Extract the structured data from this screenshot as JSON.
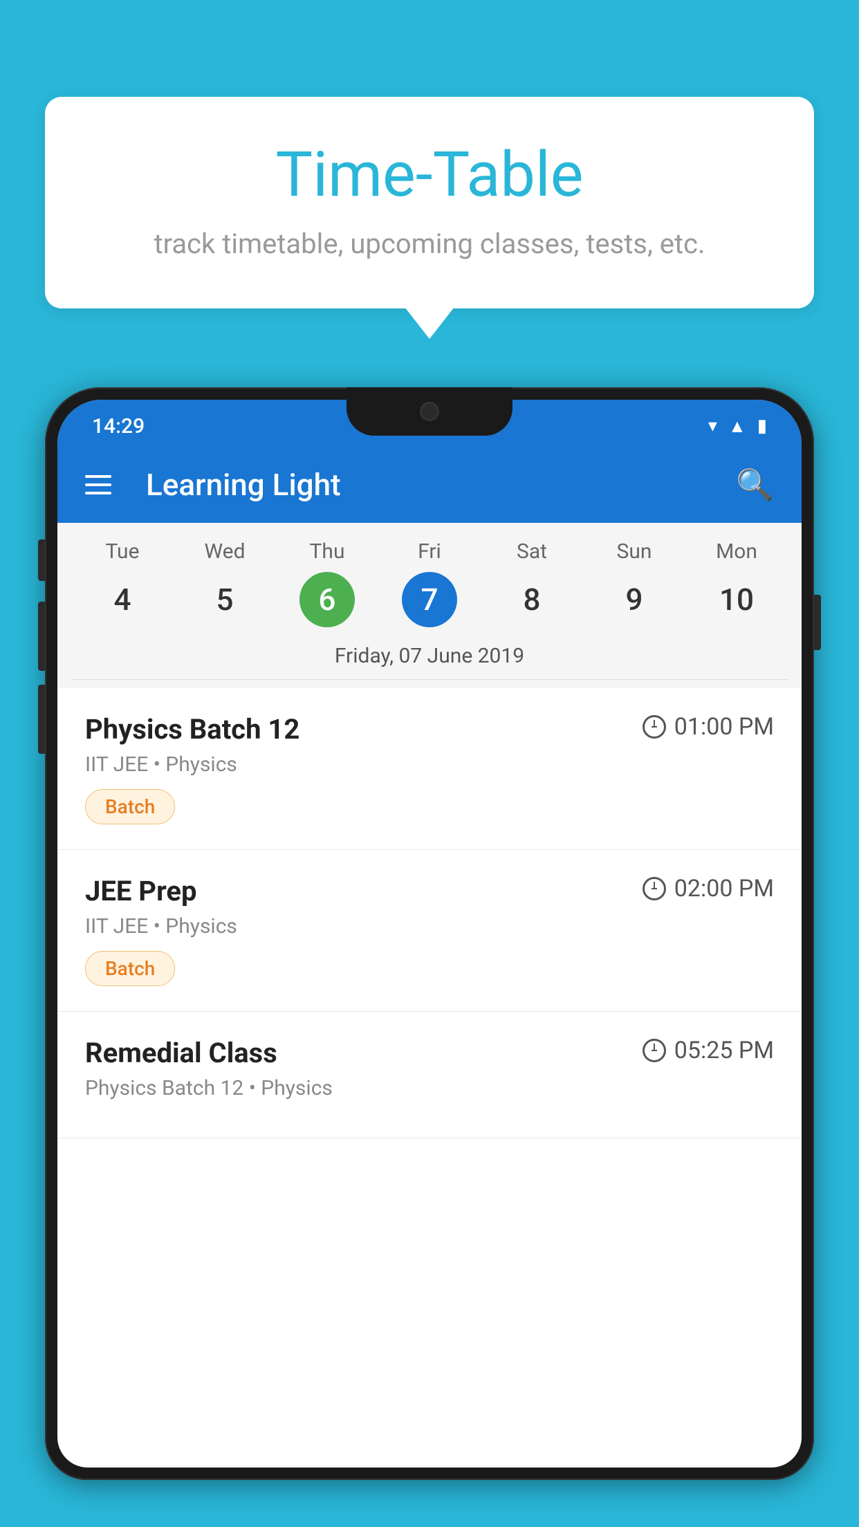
{
  "background_color": "#29b6d8",
  "bubble": {
    "title": "Time-Table",
    "subtitle": "track timetable, upcoming classes, tests, etc."
  },
  "status_bar": {
    "time": "14:29"
  },
  "app_bar": {
    "title": "Learning Light"
  },
  "calendar": {
    "days": [
      {
        "label": "Tue",
        "number": "4",
        "state": "normal"
      },
      {
        "label": "Wed",
        "number": "5",
        "state": "normal"
      },
      {
        "label": "Thu",
        "number": "6",
        "state": "today"
      },
      {
        "label": "Fri",
        "number": "7",
        "state": "selected"
      },
      {
        "label": "Sat",
        "number": "8",
        "state": "normal"
      },
      {
        "label": "Sun",
        "number": "9",
        "state": "normal"
      },
      {
        "label": "Mon",
        "number": "10",
        "state": "normal"
      }
    ],
    "selected_date_label": "Friday, 07 June 2019"
  },
  "schedule": {
    "items": [
      {
        "title": "Physics Batch 12",
        "time": "01:00 PM",
        "subtitle": "IIT JEE • Physics",
        "badge": "Batch"
      },
      {
        "title": "JEE Prep",
        "time": "02:00 PM",
        "subtitle": "IIT JEE • Physics",
        "badge": "Batch"
      },
      {
        "title": "Remedial Class",
        "time": "05:25 PM",
        "subtitle": "Physics Batch 12 • Physics",
        "badge": ""
      }
    ]
  }
}
